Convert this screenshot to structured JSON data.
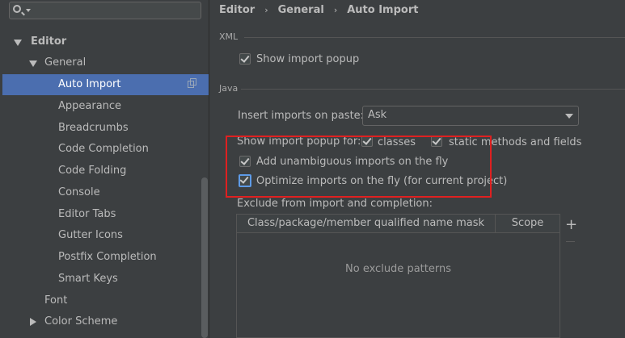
{
  "search": {
    "value": ""
  },
  "tree": {
    "editor": "Editor",
    "general": "General",
    "items": [
      "Auto Import",
      "Appearance",
      "Breadcrumbs",
      "Code Completion",
      "Code Folding",
      "Console",
      "Editor Tabs",
      "Gutter Icons",
      "Postfix Completion",
      "Smart Keys"
    ],
    "font": "Font",
    "color_scheme": "Color Scheme"
  },
  "breadcrumb": {
    "part1": "Editor",
    "part2": "General",
    "part3": "Auto Import"
  },
  "xml": {
    "title": "XML",
    "show_import_popup": "Show import popup"
  },
  "java": {
    "title": "Java",
    "insert_imports_label": "Insert imports on paste:",
    "insert_imports_value": "Ask",
    "show_popup_for": "Show import popup for:",
    "classes": "classes",
    "static_methods": "static methods and fields",
    "add_unambiguous": "Add unambiguous imports on the fly",
    "optimize_imports": "Optimize imports on the fly (for current project)"
  },
  "exclude": {
    "label": "Exclude from import and completion:",
    "col1": "Class/package/member qualified name mask",
    "col2": "Scope",
    "empty": "No exclude patterns",
    "add": "+"
  },
  "colors": {
    "highlight": "#e02020",
    "selection": "#4b6eaf"
  }
}
